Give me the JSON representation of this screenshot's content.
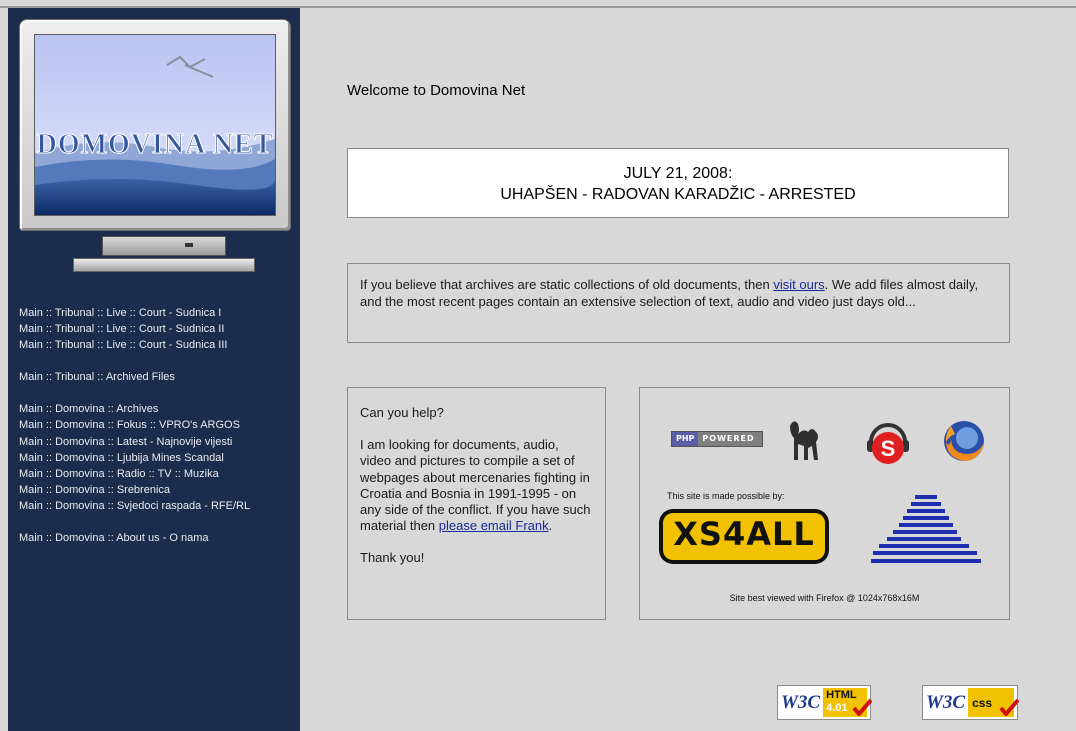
{
  "site": {
    "logo_text": "DOMOVINA NET"
  },
  "nav": {
    "group1": [
      "Main :: Tribunal :: Live :: Court - Sudnica I",
      "Main :: Tribunal :: Live :: Court - Sudnica II",
      "Main :: Tribunal :: Live :: Court - Sudnica III"
    ],
    "group2": [
      "Main :: Tribunal :: Archived Files"
    ],
    "group3": [
      "Main :: Domovina :: Archives",
      "Main :: Domovina :: Fokus :: VPRO's ARGOS",
      "Main :: Domovina :: Latest - Najnovije vijesti",
      "Main :: Domovina :: Ljubija Mines Scandal",
      "Main :: Domovina :: Radio :: TV :: Muzika",
      "Main :: Domovina :: Srebrenica",
      "Main :: Domovina :: Svjedoci raspada - RFE/RL"
    ],
    "group4": [
      "Main :: Domovina :: About us - O nama"
    ]
  },
  "main": {
    "welcome": "Welcome to Domovina Net",
    "headline_date": "JULY 21, 2008:",
    "headline_text": "UHAPŠEN - RADOVAN KARADŽIC - ARRESTED",
    "archives_text_1": "If you believe that archives are static collections of old documents, then",
    "archives_link": "visit ours",
    "archives_text_2": ".   We add files almost daily, and the most recent pages contain an extensive selection of text, audio and video just days old...",
    "help_title": "Can you help?",
    "help_text_1": "I am looking for documents, audio, video and pictures to compile a set of webpages about mercenaries fighting in Croatia and Bosnia in 1991-1995 - on any side of the conflict. If you have such material then",
    "help_link": "please email Frank",
    "help_text_2": ".",
    "help_thanks": "Thank you!"
  },
  "partners": {
    "php_left": "PHP",
    "php_right": "POWERED",
    "possible_by": "This site is made possible by:",
    "xs4all": "XS4ALL",
    "best_viewed": "Site best viewed with Firefox @ 1024x768x16M"
  },
  "badges": {
    "w3c": "W3C",
    "html_top": "HTML",
    "html_bottom": "4.01",
    "css": "css"
  },
  "colors": {
    "sidebar": "#1b2c4c",
    "background": "#d8d8d8",
    "link": "#1a2a9a",
    "xs4all_yellow": "#f2c200"
  }
}
